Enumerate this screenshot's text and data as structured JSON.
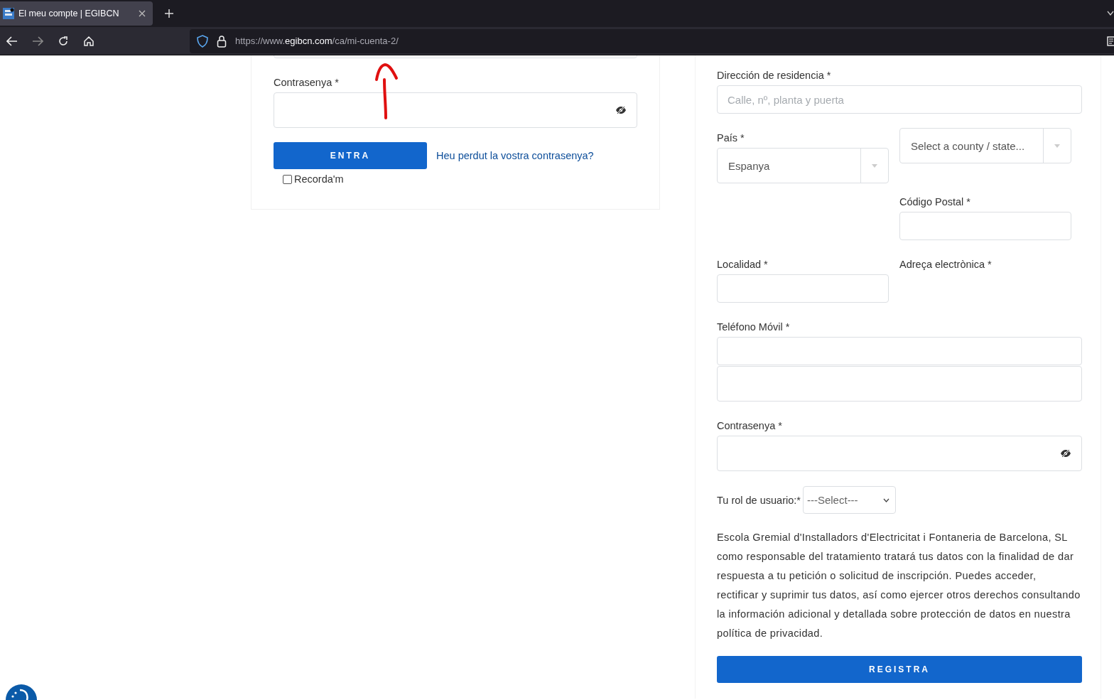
{
  "browser": {
    "tab": {
      "title": "El meu compte | EGIBCN",
      "selected": true
    },
    "url": {
      "prefix": "https://www.",
      "domain": "egibcn.com",
      "path": "/ca/mi-cuenta-2/"
    }
  },
  "login_form": {
    "password": {
      "label": "Contrasenya *"
    },
    "submit": "ENTRA",
    "lost_password_link": "Heu perdut la vostra contrasenya?",
    "remember": {
      "label": "Recorda'm",
      "checked": false
    }
  },
  "register_form": {
    "address": {
      "label": "Dirección de residencia *",
      "placeholder": "Calle, nº, planta y puerta"
    },
    "country": {
      "label": "País *",
      "value": "Espanya"
    },
    "county": {
      "placeholder": "Select a county / state..."
    },
    "postal_code": {
      "label": "Código Postal *"
    },
    "locality": {
      "label": "Localidad *"
    },
    "email": {
      "label": "Adreça electrònica *"
    },
    "mobile": {
      "label": "Teléfono Móvil *"
    },
    "password": {
      "label": "Contrasenya *"
    },
    "role": {
      "label": "Tu rol de usuario:*",
      "value": "---Select---"
    },
    "notice": "Escola Gremial d'Installadors d'Electricitat i Fontaneria de Barcelona, SL como responsable del tratamiento tratará tus datos con la finalidad de dar respuesta a tu petición o solicitud de inscripción. Puedes acceder, rectificar y suprimir tus datos, así como ejercer otros derechos consultando la información adicional y detallada sobre protección de datos en nuestra política de privacidad.",
    "submit": "REGISTRA"
  }
}
